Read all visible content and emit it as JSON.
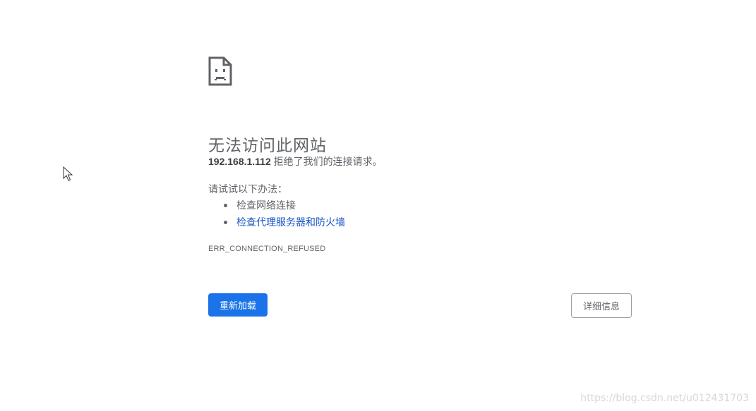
{
  "error_page": {
    "title": "无法访问此网站",
    "host": "192.168.1.112",
    "refused_message": "拒绝了我们的连接请求。",
    "try_label": "请试试以下办法：",
    "suggestions": [
      {
        "label": "检查网络连接",
        "is_link": false
      },
      {
        "label": "检查代理服务器和防火墙",
        "is_link": true
      }
    ],
    "error_code": "ERR_CONNECTION_REFUSED",
    "reload_label": "重新加载",
    "details_label": "详细信息"
  },
  "watermark": "https://blog.csdn.net/u012431703",
  "icons": {
    "page_icon": "sad-document-icon",
    "cursor": "mouse-cursor-icon"
  },
  "colors": {
    "primary_button": "#1a73e8",
    "link": "#1a56c4",
    "text_secondary": "#5f6368"
  }
}
